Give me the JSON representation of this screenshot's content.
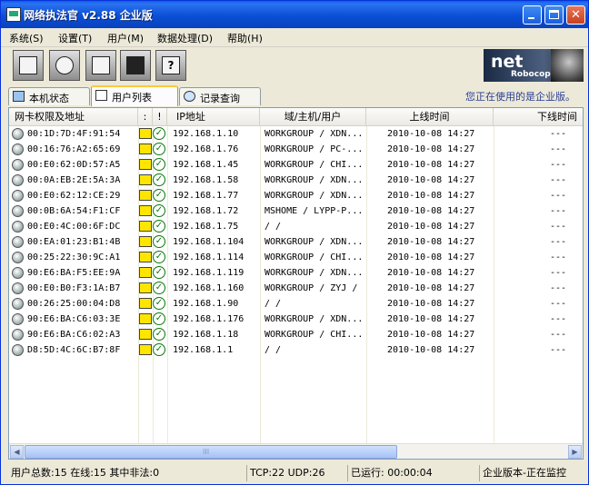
{
  "window": {
    "title": "网络执法官  v2.88 企业版",
    "accent": "#0a4fd6"
  },
  "menu": [
    "系统(S)",
    "设置(T)",
    "用户(M)",
    "数据处理(D)",
    "帮助(H)"
  ],
  "toolbar": {
    "icons": [
      "device-info-icon",
      "settings-gear-icon",
      "keyboard-rules-icon",
      "monitor-icon",
      "help-book-icon"
    ]
  },
  "logo": {
    "text": "net",
    "subtext": "Robocop"
  },
  "tabs": [
    {
      "label": "本机状态",
      "icon": "computer-icon",
      "active": false
    },
    {
      "label": "用户列表",
      "icon": "user-list-icon",
      "active": true
    },
    {
      "label": "记录查询",
      "icon": "magnifier-icon",
      "active": false
    }
  ],
  "edition_note": "您正在使用的是企业版。",
  "table": {
    "columns": [
      "网卡权限及地址",
      ":",
      "!",
      "IP地址",
      "域/主机/用户",
      "上线时间",
      "下线时间"
    ],
    "rows": [
      {
        "mac": "00:1D:7D:4F:91:54",
        "ip": "192.168.1.10",
        "host": "WORKGROUP / XDN...",
        "online": "2010-10-08 14:27",
        "offline": "---"
      },
      {
        "mac": "00:16:76:A2:65:69",
        "ip": "192.168.1.76",
        "host": "WORKGROUP / PC-...",
        "online": "2010-10-08 14:27",
        "offline": "---"
      },
      {
        "mac": "00:E0:62:0D:57:A5",
        "ip": "192.168.1.45",
        "host": "WORKGROUP / CHI...",
        "online": "2010-10-08 14:27",
        "offline": "---"
      },
      {
        "mac": "00:0A:EB:2E:5A:3A",
        "ip": "192.168.1.58",
        "host": "WORKGROUP / XDN...",
        "online": "2010-10-08 14:27",
        "offline": "---"
      },
      {
        "mac": "00:E0:62:12:CE:29",
        "ip": "192.168.1.77",
        "host": "WORKGROUP / XDN...",
        "online": "2010-10-08 14:27",
        "offline": "---"
      },
      {
        "mac": "00:0B:6A:54:F1:CF",
        "ip": "192.168.1.72",
        "host": "MSHOME / LYPP-P...",
        "online": "2010-10-08 14:27",
        "offline": "---"
      },
      {
        "mac": "00:E0:4C:00:6F:DC",
        "ip": "192.168.1.75",
        "host": " /  /",
        "online": "2010-10-08 14:27",
        "offline": "---"
      },
      {
        "mac": "00:EA:01:23:B1:4B",
        "ip": "192.168.1.104",
        "host": "WORKGROUP / XDN...",
        "online": "2010-10-08 14:27",
        "offline": "---"
      },
      {
        "mac": "00:25:22:30:9C:A1",
        "ip": "192.168.1.114",
        "host": "WORKGROUP / CHI...",
        "online": "2010-10-08 14:27",
        "offline": "---"
      },
      {
        "mac": "90:E6:BA:F5:EE:9A",
        "ip": "192.168.1.119",
        "host": "WORKGROUP / XDN...",
        "online": "2010-10-08 14:27",
        "offline": "---"
      },
      {
        "mac": "00:E0:B0:F3:1A:B7",
        "ip": "192.168.1.160",
        "host": "WORKGROUP / ZYJ /",
        "online": "2010-10-08 14:27",
        "offline": "---"
      },
      {
        "mac": "00:26:25:00:04:D8",
        "ip": "192.168.1.90",
        "host": " /  /",
        "online": "2010-10-08 14:27",
        "offline": "---"
      },
      {
        "mac": "90:E6:BA:C6:03:3E",
        "ip": "192.168.1.176",
        "host": "WORKGROUP / XDN...",
        "online": "2010-10-08 14:27",
        "offline": "---"
      },
      {
        "mac": "90:E6:BA:C6:02:A3",
        "ip": "192.168.1.18",
        "host": "WORKGROUP / CHI...",
        "online": "2010-10-08 14:27",
        "offline": "---"
      },
      {
        "mac": "D8:5D:4C:6C:B7:8F",
        "ip": "192.168.1.1",
        "host": " /  /",
        "online": "2010-10-08 14:27",
        "offline": "---"
      }
    ]
  },
  "scrollbar": {
    "thumb_grip": "III"
  },
  "status": {
    "users": "用户总数:15 在线:15 其中非法:0",
    "tcp_udp": "TCP:22 UDP:26",
    "runtime": "已运行: 00:00:04",
    "mode": "企业版本-正在监控"
  }
}
